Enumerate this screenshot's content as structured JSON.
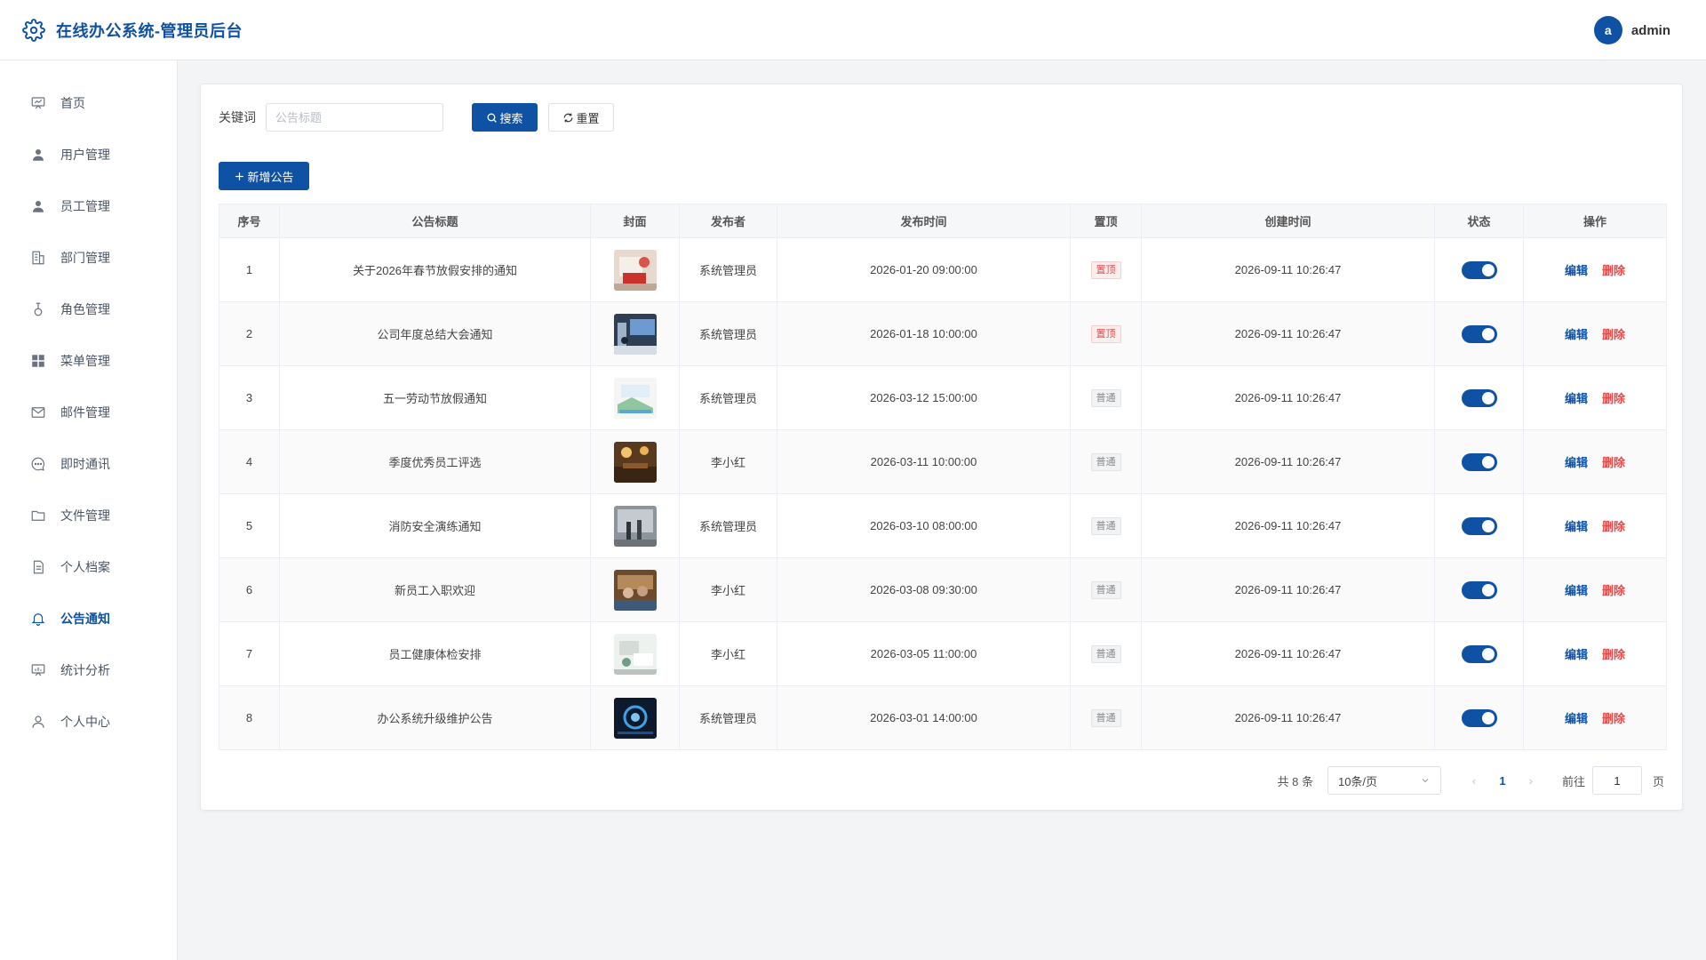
{
  "header": {
    "title": "在线办公系统-管理员后台",
    "avatar_letter": "a",
    "user_name": "admin"
  },
  "sidebar": {
    "items": [
      {
        "label": "首页",
        "icon": "dashboard-icon",
        "active": false
      },
      {
        "label": "用户管理",
        "icon": "user-icon",
        "active": false
      },
      {
        "label": "员工管理",
        "icon": "user-icon",
        "active": false
      },
      {
        "label": "部门管理",
        "icon": "building-icon",
        "active": false
      },
      {
        "label": "角色管理",
        "icon": "role-icon",
        "active": false
      },
      {
        "label": "菜单管理",
        "icon": "grid-icon",
        "active": false
      },
      {
        "label": "邮件管理",
        "icon": "mail-icon",
        "active": false
      },
      {
        "label": "即时通讯",
        "icon": "chat-icon",
        "active": false
      },
      {
        "label": "文件管理",
        "icon": "folder-icon",
        "active": false
      },
      {
        "label": "个人档案",
        "icon": "document-icon",
        "active": false
      },
      {
        "label": "公告通知",
        "icon": "bell-icon",
        "active": true
      },
      {
        "label": "统计分析",
        "icon": "chart-icon",
        "active": false
      },
      {
        "label": "个人中心",
        "icon": "person-icon",
        "active": false
      }
    ]
  },
  "search": {
    "label": "关键词",
    "placeholder": "公告标题",
    "value": "",
    "search_label": "搜索",
    "reset_label": "重置"
  },
  "toolbar": {
    "add_label": "新增公告"
  },
  "table": {
    "columns": [
      "序号",
      "公告标题",
      "封面",
      "发布者",
      "发布时间",
      "置顶",
      "创建时间",
      "状态",
      "操作"
    ],
    "rows": [
      {
        "index": "1",
        "title": "关于2026年春节放假安排的通知",
        "publisher": "系统管理员",
        "publish_time": "2026-01-20 09:00:00",
        "pinned": "置顶",
        "pinned_type": "top",
        "created_time": "2026-09-11 10:26:47",
        "status": true
      },
      {
        "index": "2",
        "title": "公司年度总结大会通知",
        "publisher": "系统管理员",
        "publish_time": "2026-01-18 10:00:00",
        "pinned": "置顶",
        "pinned_type": "top",
        "created_time": "2026-09-11 10:26:47",
        "status": true
      },
      {
        "index": "3",
        "title": "五一劳动节放假通知",
        "publisher": "系统管理员",
        "publish_time": "2026-03-12 15:00:00",
        "pinned": "普通",
        "pinned_type": "normal",
        "created_time": "2026-09-11 10:26:47",
        "status": true
      },
      {
        "index": "4",
        "title": "季度优秀员工评选",
        "publisher": "李小红",
        "publish_time": "2026-03-11 10:00:00",
        "pinned": "普通",
        "pinned_type": "normal",
        "created_time": "2026-09-11 10:26:47",
        "status": true
      },
      {
        "index": "5",
        "title": "消防安全演练通知",
        "publisher": "系统管理员",
        "publish_time": "2026-03-10 08:00:00",
        "pinned": "普通",
        "pinned_type": "normal",
        "created_time": "2026-09-11 10:26:47",
        "status": true
      },
      {
        "index": "6",
        "title": "新员工入职欢迎",
        "publisher": "李小红",
        "publish_time": "2026-03-08 09:30:00",
        "pinned": "普通",
        "pinned_type": "normal",
        "created_time": "2026-09-11 10:26:47",
        "status": true
      },
      {
        "index": "7",
        "title": "员工健康体检安排",
        "publisher": "李小红",
        "publish_time": "2026-03-05 11:00:00",
        "pinned": "普通",
        "pinned_type": "normal",
        "created_time": "2026-09-11 10:26:47",
        "status": true
      },
      {
        "index": "8",
        "title": "办公系统升级维护公告",
        "publisher": "系统管理员",
        "publish_time": "2026-03-01 14:00:00",
        "pinned": "普通",
        "pinned_type": "normal",
        "created_time": "2026-09-11 10:26:47",
        "status": true
      }
    ],
    "edit_label": "编辑",
    "delete_label": "删除"
  },
  "pagination": {
    "total_text": "共 8 条",
    "page_size": "10条/页",
    "current_page": "1",
    "goto_label": "前往",
    "goto_value": "1",
    "page_suffix": "页"
  },
  "colors": {
    "primary": "#0f52a4",
    "danger": "#e34b4b",
    "background": "#f3f4f6"
  }
}
